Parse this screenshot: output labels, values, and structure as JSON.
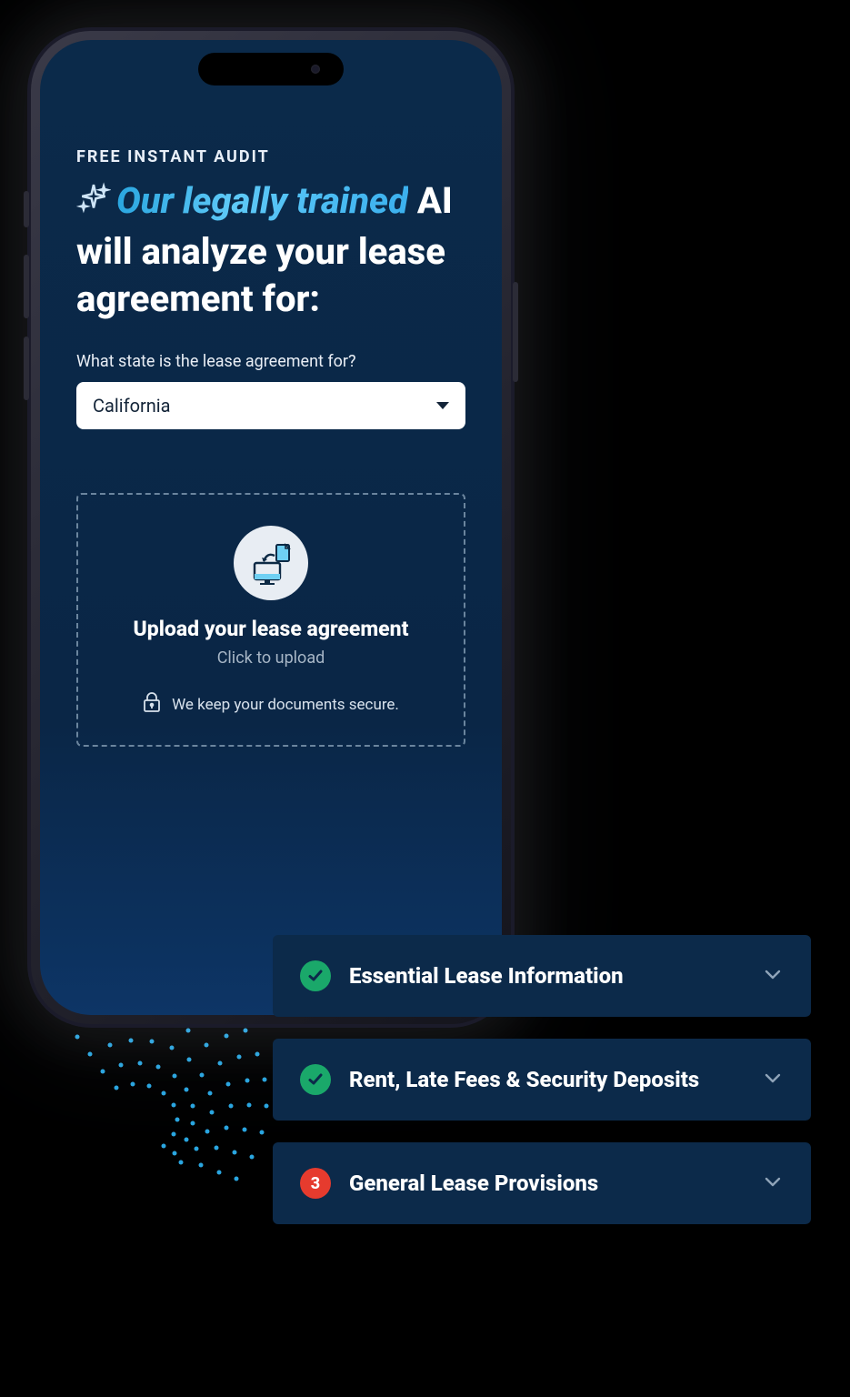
{
  "hero": {
    "eyebrow": "FREE INSTANT AUDIT",
    "headline_grad": "Our legally trained",
    "headline_mid": " AI",
    "headline_rest": " will analyze your",
    "headline_tail": " lease agreement for:"
  },
  "stateSelect": {
    "label": "What state is the lease agreement for?",
    "value": "California"
  },
  "upload": {
    "title": "Upload your lease agreement",
    "subtitle": "Click to upload",
    "secure": "We keep your documents secure."
  },
  "accordion": [
    {
      "status": "ok",
      "title": "Essential Lease Information"
    },
    {
      "status": "ok",
      "title": "Rent, Late Fees & Security Deposits"
    },
    {
      "status": "count",
      "badge": "3",
      "title": "General Lease Provisions"
    }
  ]
}
